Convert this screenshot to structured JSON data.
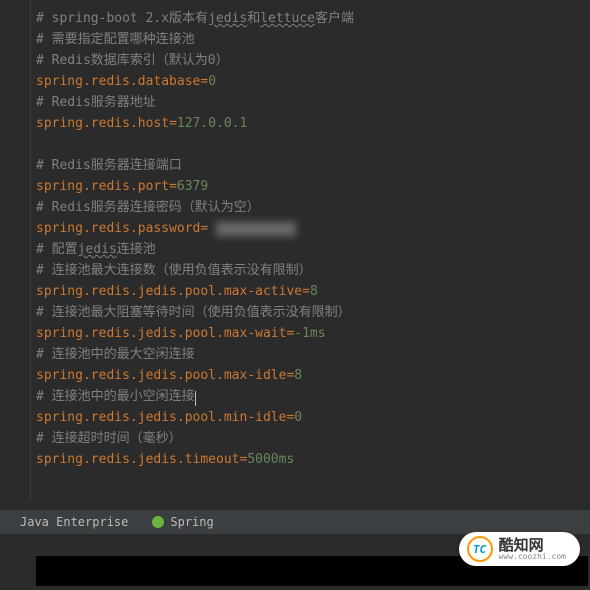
{
  "lines": [
    {
      "type": "comment",
      "text": "# spring-boot 2.x版本有jedis和lettuce客户端",
      "wavy": [
        "jedis",
        "lettuce"
      ]
    },
    {
      "type": "comment",
      "text": "# 需要指定配置哪种连接池"
    },
    {
      "type": "comment",
      "text": "# Redis数据库索引（默认为0）"
    },
    {
      "type": "prop",
      "key": "spring.redis.database",
      "value": "0"
    },
    {
      "type": "comment",
      "text": "# Redis服务器地址"
    },
    {
      "type": "prop",
      "key": "spring.redis.host",
      "value": "127.0.0.1"
    },
    {
      "type": "blank",
      "text": ""
    },
    {
      "type": "comment",
      "text": "# Redis服务器连接端口"
    },
    {
      "type": "prop",
      "key": "spring.redis.port",
      "value": "6379"
    },
    {
      "type": "comment",
      "text": "# Redis服务器连接密码（默认为空）"
    },
    {
      "type": "prop-blur",
      "key": "spring.redis.password",
      "value": " "
    },
    {
      "type": "comment",
      "text": "# 配置jedis连接池",
      "wavy": [
        "jedis"
      ]
    },
    {
      "type": "comment",
      "text": "# 连接池最大连接数（使用负值表示没有限制）"
    },
    {
      "type": "prop",
      "key": "spring.redis.jedis.pool.max-active",
      "value": "8"
    },
    {
      "type": "comment",
      "text": "# 连接池最大阻塞等待时间（使用负值表示没有限制）"
    },
    {
      "type": "prop",
      "key": "spring.redis.jedis.pool.max-wait",
      "value": "-1ms"
    },
    {
      "type": "comment",
      "text": "# 连接池中的最大空闲连接"
    },
    {
      "type": "prop",
      "key": "spring.redis.jedis.pool.max-idle",
      "value": "8"
    },
    {
      "type": "comment-cursor",
      "text": "# 连接池中的最小空闲连接"
    },
    {
      "type": "prop",
      "key": "spring.redis.jedis.pool.min-idle",
      "value": "0"
    },
    {
      "type": "comment",
      "text": "# 连接超时时间（毫秒）"
    },
    {
      "type": "prop",
      "key": "spring.redis.jedis.timeout",
      "value": "5000ms"
    }
  ],
  "tabs": {
    "java": "Java Enterprise",
    "spring": "Spring"
  },
  "watermark": {
    "icon": "TC",
    "cn": "酷知网",
    "url": "www.coozhi.com"
  }
}
